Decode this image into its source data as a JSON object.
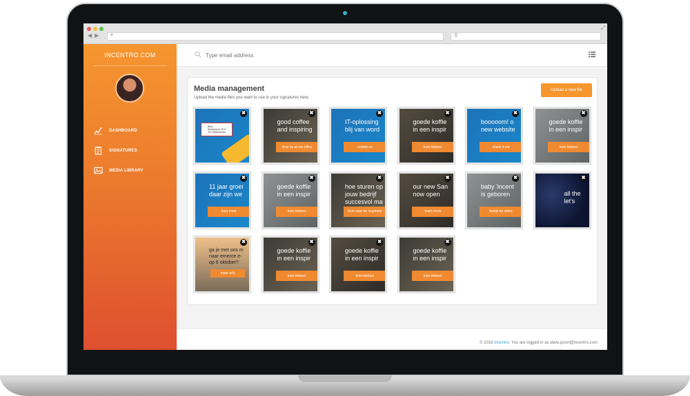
{
  "sidebar": {
    "brand": "INCENTRO.COM",
    "items": [
      {
        "label": "DASHBOARD",
        "icon": "chart-line-icon"
      },
      {
        "label": "SIGNATURES",
        "icon": "clipboard-icon"
      },
      {
        "label": "MEDIA LIBRARY",
        "icon": "image-icon"
      }
    ]
  },
  "topbar": {
    "search_placeholder": "Type email address"
  },
  "media": {
    "title": "Media management",
    "subtitle": "Upload the media files you want to use in your signatures here.",
    "upload_label": "Upload a new file",
    "tiles": [
      {
        "text": "Best\nWorkplaces 2017\nThe Netherlands",
        "button": "",
        "bg": "award"
      },
      {
        "text": "good coffee\nand inspiring",
        "button": "drop by at our office",
        "bg": "dark"
      },
      {
        "text": "IT-oplossing\nblij van word",
        "button": "ontdek nu",
        "bg": "blue"
      },
      {
        "text": "goede koffie\nin een inspir",
        "button": "kom kletsen",
        "bg": "dark2"
      },
      {
        "text": "booooom! o\nnew website",
        "button": "check it out",
        "bg": "blue"
      },
      {
        "text": "goede koffie\nin een inspir",
        "button": "kom kletsen",
        "bg": "grey"
      },
      {
        "text": "11 jaar groei\ndaar zijn we",
        "button": "lees meer",
        "bg": "blue"
      },
      {
        "text": "goede koffie\nin een inspir",
        "button": "kom kletsen",
        "bg": "grey"
      },
      {
        "text": "hoe sturen op\njouw bedrijf\nsuccesvol ma",
        "button": "kom naar de inspiratie",
        "bg": "dark"
      },
      {
        "text": "our new San\nnow open",
        "button": "learn more",
        "bg": "dark2"
      },
      {
        "text": "baby 'incent\nis geboren",
        "button": "bekijk de video",
        "bg": "grey"
      },
      {
        "text": "all the\nlet's",
        "button": "",
        "bg": "night"
      },
      {
        "text": "ga je met ons m\nnaar emerce e-\nop 6 oktober?",
        "button": "meer info",
        "bg": "sunset"
      },
      {
        "text": "goede koffie\nin een inspir",
        "button": "kom kletsen",
        "bg": "dark"
      },
      {
        "text": "goede koffie\nin een inspir",
        "button": "kom kletsen",
        "bg": "dark2"
      },
      {
        "text": "goede koffie\nin een inspir",
        "button": "kom kletsen",
        "bg": "dark"
      }
    ],
    "close_glyph": "✖"
  },
  "footer": {
    "prefix": "© 2016",
    "company": "Incentro",
    "middle": ". You are logged in as",
    "email": "dave.poort@incentro.com"
  },
  "colors": {
    "accent": "#f5962f",
    "sidebar_top": "#f5962f",
    "sidebar_bottom": "#de4f2f",
    "link": "#2ea2d4"
  }
}
